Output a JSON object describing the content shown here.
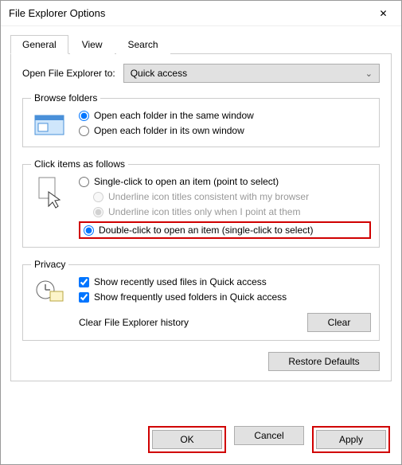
{
  "window": {
    "title": "File Explorer Options"
  },
  "tabs": {
    "general": "General",
    "view": "View",
    "search": "Search"
  },
  "open_to": {
    "label": "Open File Explorer to:",
    "value": "Quick access"
  },
  "browse": {
    "legend": "Browse folders",
    "same_window": "Open each folder in the same window",
    "own_window": "Open each folder in its own window"
  },
  "click_items": {
    "legend": "Click items as follows",
    "single": "Single-click to open an item (point to select)",
    "underline_browser": "Underline icon titles consistent with my browser",
    "underline_point": "Underline icon titles only when I point at them",
    "double": "Double-click to open an item (single-click to select)"
  },
  "privacy": {
    "legend": "Privacy",
    "recent_files": "Show recently used files in Quick access",
    "frequent_folders": "Show frequently used folders in Quick access",
    "clear_label": "Clear File Explorer history",
    "clear_btn": "Clear"
  },
  "restore": "Restore Defaults",
  "footer": {
    "ok": "OK",
    "cancel": "Cancel",
    "apply": "Apply"
  }
}
